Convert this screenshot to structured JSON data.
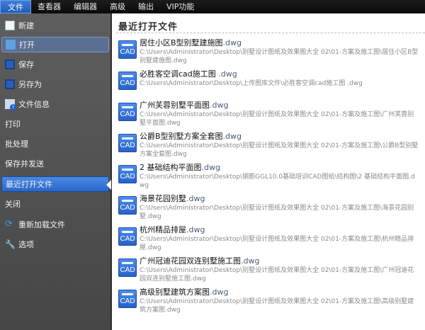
{
  "menubar": {
    "tabs": [
      "文件",
      "查看器",
      "编辑器",
      "高级",
      "输出",
      "VIP功能"
    ]
  },
  "sidebar": {
    "items": [
      {
        "label": "新建",
        "icon": "new-file-icon"
      },
      {
        "label": "打开",
        "icon": "folder-open-icon"
      },
      {
        "label": "保存",
        "icon": "save-icon"
      },
      {
        "label": "另存为",
        "icon": "save-as-icon"
      },
      {
        "label": "文件信息",
        "icon": "file-info-icon"
      },
      {
        "label": "打印"
      },
      {
        "label": "批处理"
      },
      {
        "label": "保存并发送"
      },
      {
        "label": "最近打开文件"
      },
      {
        "label": "关闭"
      },
      {
        "label": "重新加载文件",
        "icon": "reload-icon"
      },
      {
        "label": "选项",
        "icon": "wrench-icon"
      }
    ]
  },
  "main": {
    "title": "最近打开文件",
    "icon_label": "CAD",
    "files": [
      {
        "name": "居住小区B型别墅建施图",
        "ext": ".dwg",
        "path": "C:\\Users\\Administrator\\Desktop\\别墅设计图纸及效果图大全 02\\01-方案及施工图\\居住小区B型别墅建施图.dwg"
      },
      {
        "name": "必胜客空调cad施工图 ",
        "ext": ".dwg",
        "path": "C:\\Users\\Administrator\\Desktop\\上传图库文件\\必胜客空调cad施工图 .dwg"
      },
      {
        "name": "广州芙蓉别墅平面图",
        "ext": ".dwg",
        "path": "C:\\Users\\Administrator\\Desktop\\别墅设计图纸及效果图大全 02\\01-方案及施工图\\广州芙蓉别墅平面图.dwg"
      },
      {
        "name": "公爵B型别墅方案全套图",
        "ext": ".dwg",
        "path": "C:\\Users\\Administrator\\Desktop\\别墅设计图纸及效果图大全 02\\01-方案及施工图\\公爵B型别墅方案全套图.dwg"
      },
      {
        "name": "2 基础结构平面图",
        "ext": ".dwg",
        "path": "C:\\Users\\Administrator\\Desktop\\钢筋GGL10.0基础培训CAD图纸\\结构图\\2 基础结构平面图.dwg"
      },
      {
        "name": "海景花园别墅",
        "ext": ".dwg",
        "path": "C:\\Users\\Administrator\\Desktop\\别墅设计图纸及效果图大全 02\\01-方案及施工图\\海景花园别墅.dwg"
      },
      {
        "name": "杭州精品排屋",
        "ext": ".dwg",
        "path": "C:\\Users\\Administrator\\Desktop\\别墅设计图纸及效果图大全 02\\01-方案及施工图\\杭州精品排屋.dwg"
      },
      {
        "name": "广州冠迪花园双连别墅施工图",
        "ext": ".dwg",
        "path": "C:\\Users\\Administrator\\Desktop\\别墅设计图纸及效果图大全 02\\01-方案及施工图\\广州冠迪花园双连别墅施工图.dwg"
      },
      {
        "name": "高级别墅建筑方案图",
        "ext": ".dwg",
        "path": "C:\\Users\\Administrator\\Desktop\\别墅设计图纸及效果图大全 02\\01-方案及施工图\\高级别墅建筑方案图.dwg"
      }
    ]
  }
}
